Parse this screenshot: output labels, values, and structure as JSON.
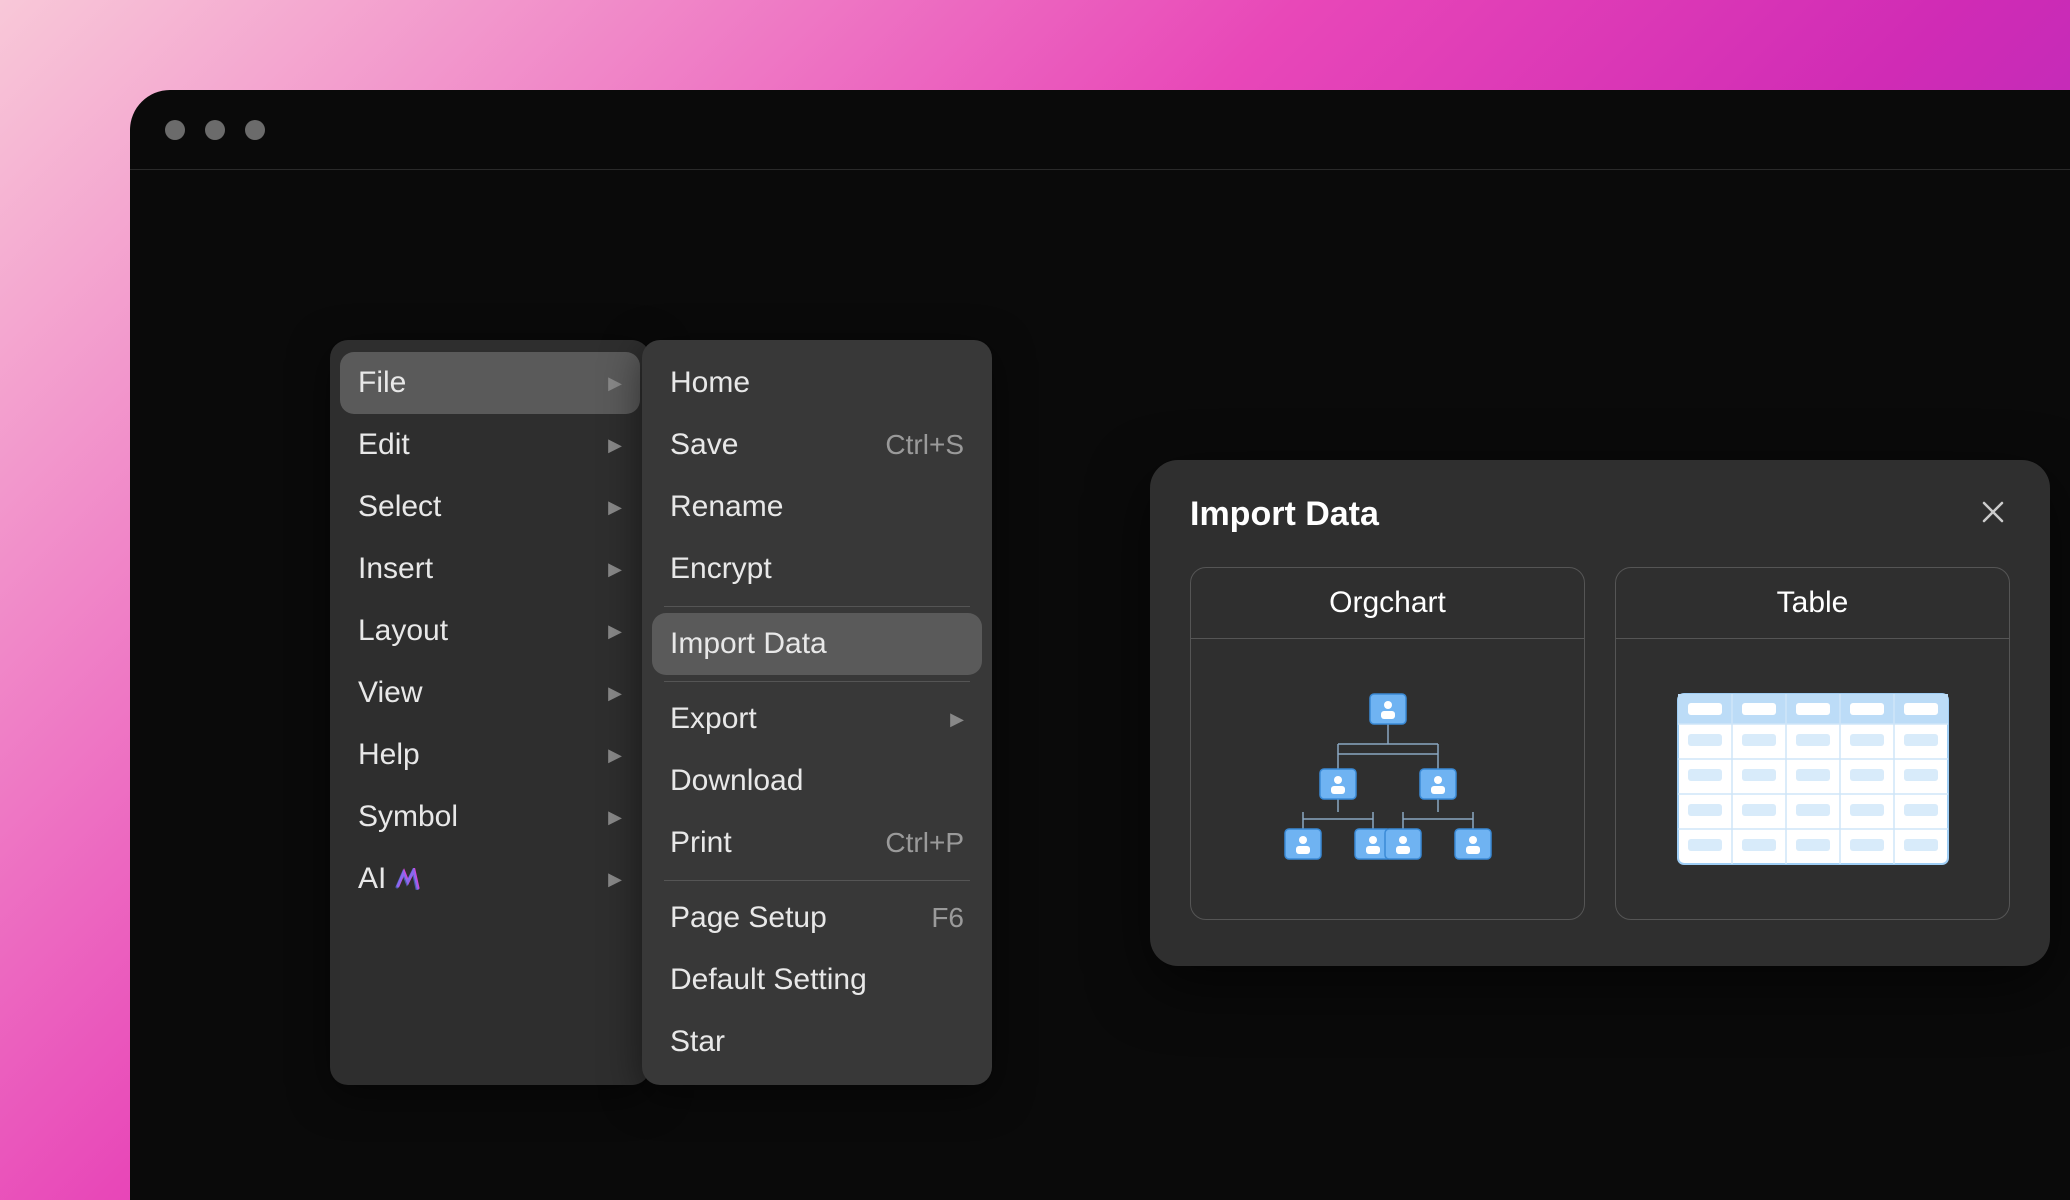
{
  "primary_menu": {
    "items": [
      {
        "label": "File",
        "has_submenu": true,
        "highlighted": true
      },
      {
        "label": "Edit",
        "has_submenu": true
      },
      {
        "label": "Select",
        "has_submenu": true
      },
      {
        "label": "Insert",
        "has_submenu": true
      },
      {
        "label": "Layout",
        "has_submenu": true
      },
      {
        "label": "View",
        "has_submenu": true
      },
      {
        "label": "Help",
        "has_submenu": true
      },
      {
        "label": "Symbol",
        "has_submenu": true
      },
      {
        "label": "AI",
        "has_submenu": true,
        "ai_icon": true
      }
    ]
  },
  "file_submenu": {
    "groups": [
      [
        {
          "label": "Home"
        },
        {
          "label": "Save",
          "shortcut": "Ctrl+S"
        },
        {
          "label": "Rename"
        },
        {
          "label": "Encrypt"
        }
      ],
      [
        {
          "label": "Import Data",
          "highlighted": true
        }
      ],
      [
        {
          "label": "Export",
          "has_submenu": true
        },
        {
          "label": "Download"
        },
        {
          "label": "Print",
          "shortcut": "Ctrl+P"
        }
      ],
      [
        {
          "label": "Page Setup",
          "shortcut": "F6"
        },
        {
          "label": "Default Setting"
        },
        {
          "label": "Star"
        }
      ]
    ]
  },
  "dialog": {
    "title": "Import Data",
    "options": [
      {
        "label": "Orgchart"
      },
      {
        "label": "Table"
      }
    ]
  },
  "colors": {
    "node_blue": "#6fb3f2",
    "node_border": "#3a8ad6",
    "table_header": "#9fcef5",
    "table_cell": "#e8f3fc"
  }
}
